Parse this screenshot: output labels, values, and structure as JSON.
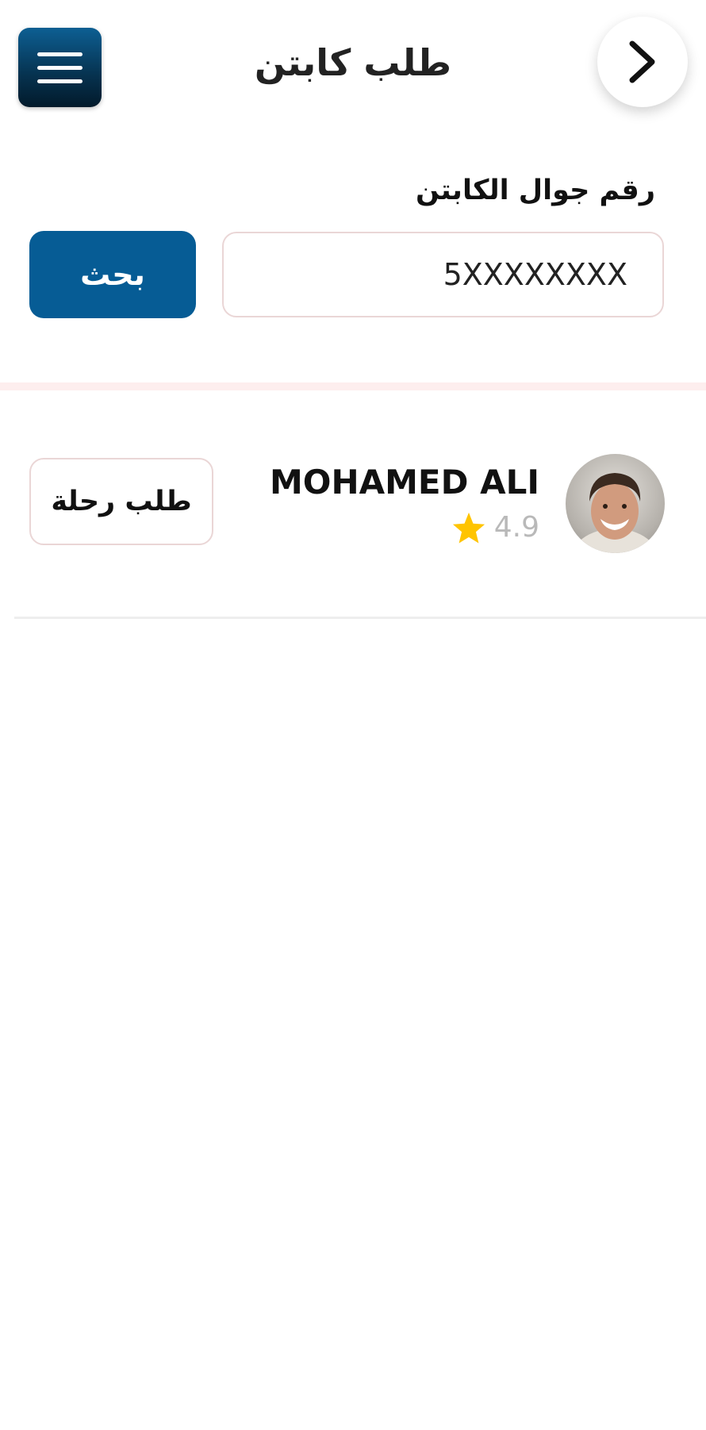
{
  "header": {
    "title": "طلب كابتن",
    "menu_icon": "hamburger-menu-icon",
    "back_icon": "chevron-right-icon"
  },
  "search": {
    "label": "رقم جوال الكابتن",
    "input_value": "5XXXXXXXX",
    "button_label": "بحث"
  },
  "results": [
    {
      "name": "MOHAMED ALI",
      "rating": "4.9",
      "rating_icon": "star-icon",
      "request_button_label": "طلب رحلة"
    }
  ],
  "colors": {
    "primary": "#065c95",
    "menu_gradient_top": "#0d5f93",
    "menu_gradient_bottom": "#021a2b",
    "border": "#ead6d6",
    "section_divider": "#fdeeee",
    "star": "#ffc400",
    "rating_text": "#b9b9b9"
  }
}
